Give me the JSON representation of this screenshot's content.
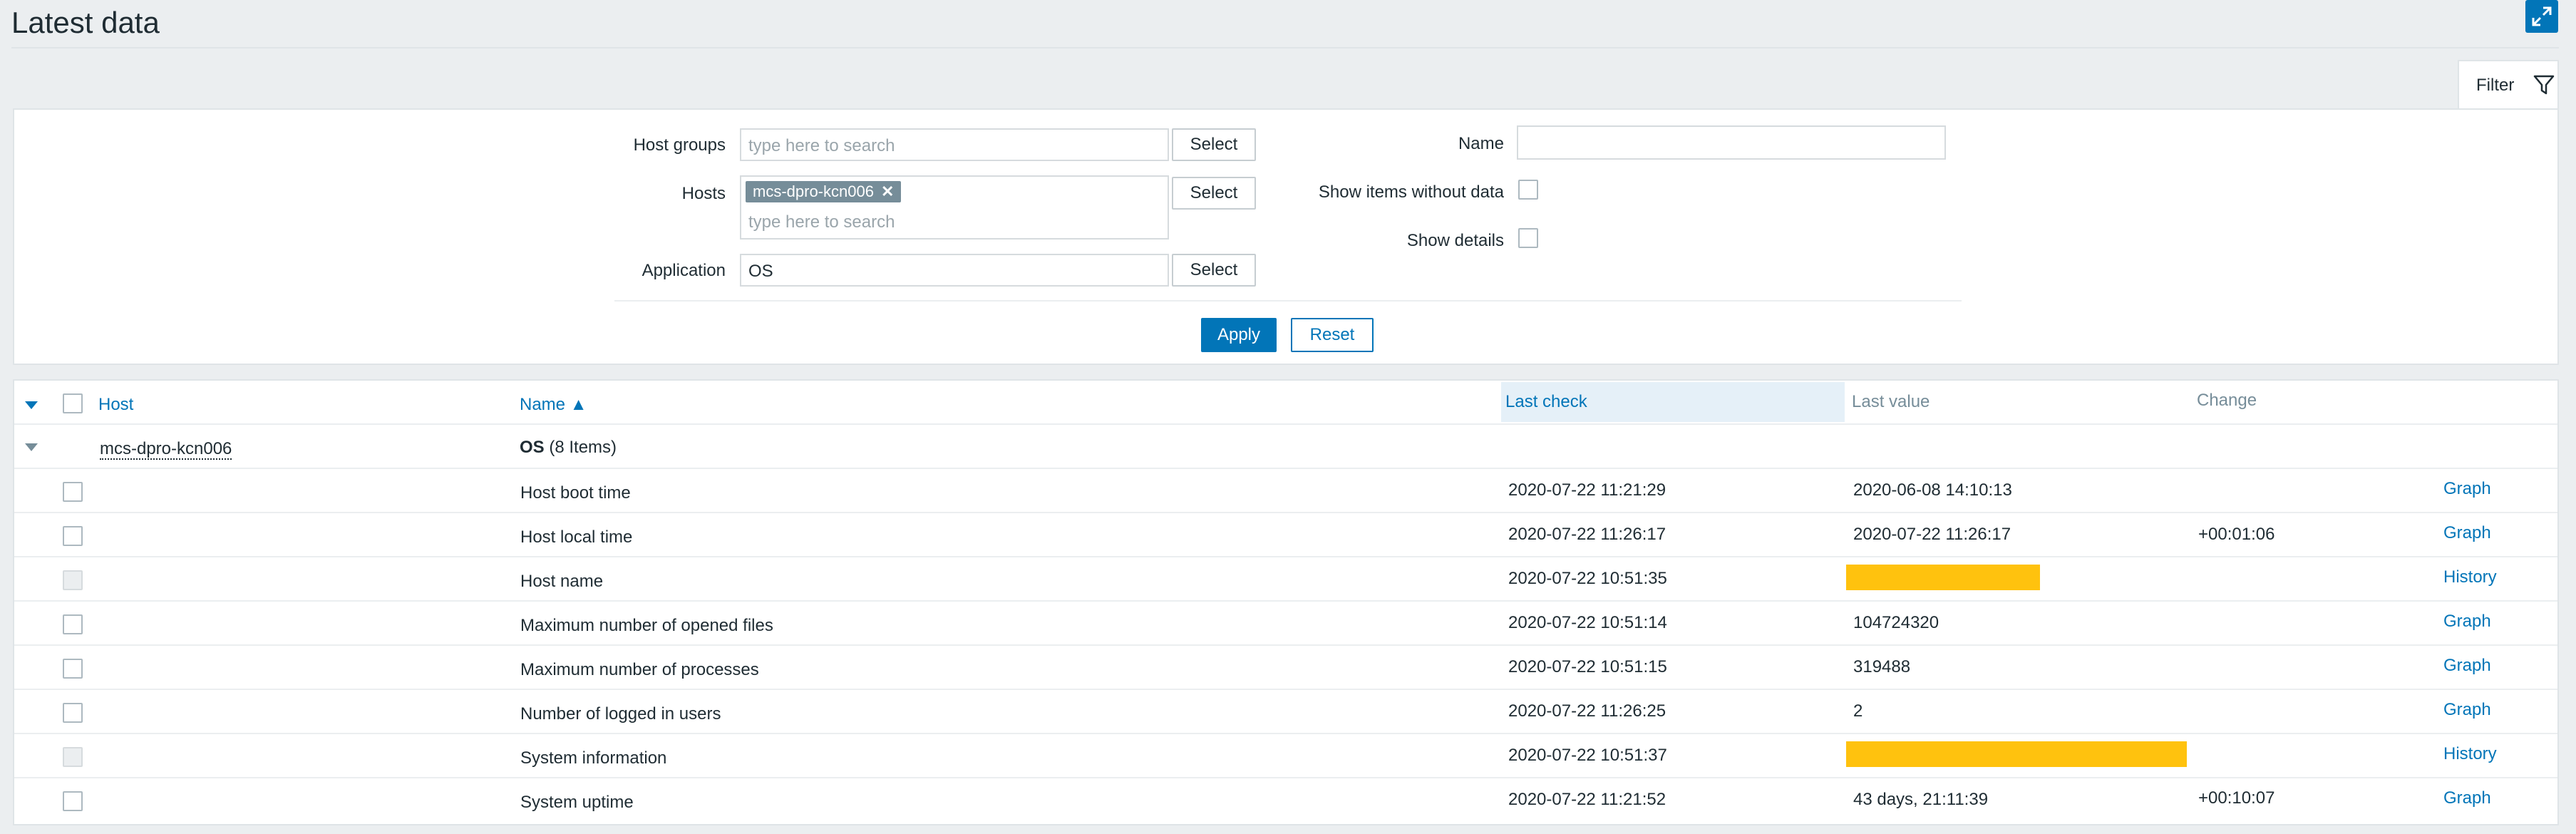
{
  "page": {
    "title": "Latest data"
  },
  "icons": {
    "fullscreen": "expand-icon",
    "filter": "funnel-icon",
    "sort": "triangle-up-icon",
    "collapse": "triangle-down-icon",
    "remove": "x-icon"
  },
  "colors": {
    "accent": "#0275b8",
    "redaction": "#ffc20e",
    "page_bg": "#ebeef0"
  },
  "filter": {
    "tab_label": "Filter",
    "host_groups_label": "Host groups",
    "host_groups_placeholder": "type here to search",
    "hosts_label": "Hosts",
    "hosts_chip": "mcs-dpro-kcn006",
    "hosts_placeholder": "type here to search",
    "application_label": "Application",
    "application_value": "OS",
    "select_label": "Select",
    "name_label": "Name",
    "name_value": "",
    "show_without_data_label": "Show items without data",
    "show_details_label": "Show details",
    "apply_label": "Apply",
    "reset_label": "Reset"
  },
  "table": {
    "headers": {
      "host": "Host",
      "name": "Name ▲",
      "last_check": "Last check",
      "last_value": "Last value",
      "change": "Change"
    },
    "group": {
      "host": "mcs-dpro-kcn006",
      "app": "OS",
      "count": "(8 Items)"
    },
    "rows": [
      {
        "name": "Host boot time",
        "last_check": "2020-07-22 11:21:29",
        "last_value": "2020-06-08 14:10:13",
        "change": "",
        "action": "Graph"
      },
      {
        "name": "Host local time",
        "last_check": "2020-07-22 11:26:17",
        "last_value": "2020-07-22 11:26:17",
        "change": "+00:01:06",
        "action": "Graph"
      },
      {
        "name": "Host name",
        "last_check": "2020-07-22 10:51:35",
        "last_value": "",
        "change": "",
        "action": "History"
      },
      {
        "name": "Maximum number of opened files",
        "last_check": "2020-07-22 10:51:14",
        "last_value": "104724320",
        "change": "",
        "action": "Graph"
      },
      {
        "name": "Maximum number of processes",
        "last_check": "2020-07-22 10:51:15",
        "last_value": "319488",
        "change": "",
        "action": "Graph"
      },
      {
        "name": "Number of logged in users",
        "last_check": "2020-07-22 11:26:25",
        "last_value": "2",
        "change": "",
        "action": "Graph"
      },
      {
        "name": "System information",
        "last_check": "2020-07-22 10:51:37",
        "last_value": "",
        "change": "",
        "action": "History"
      },
      {
        "name": "System uptime",
        "last_check": "2020-07-22 11:21:52",
        "last_value": "43 days, 21:11:39",
        "change": "+00:10:07",
        "action": "Graph"
      }
    ]
  }
}
